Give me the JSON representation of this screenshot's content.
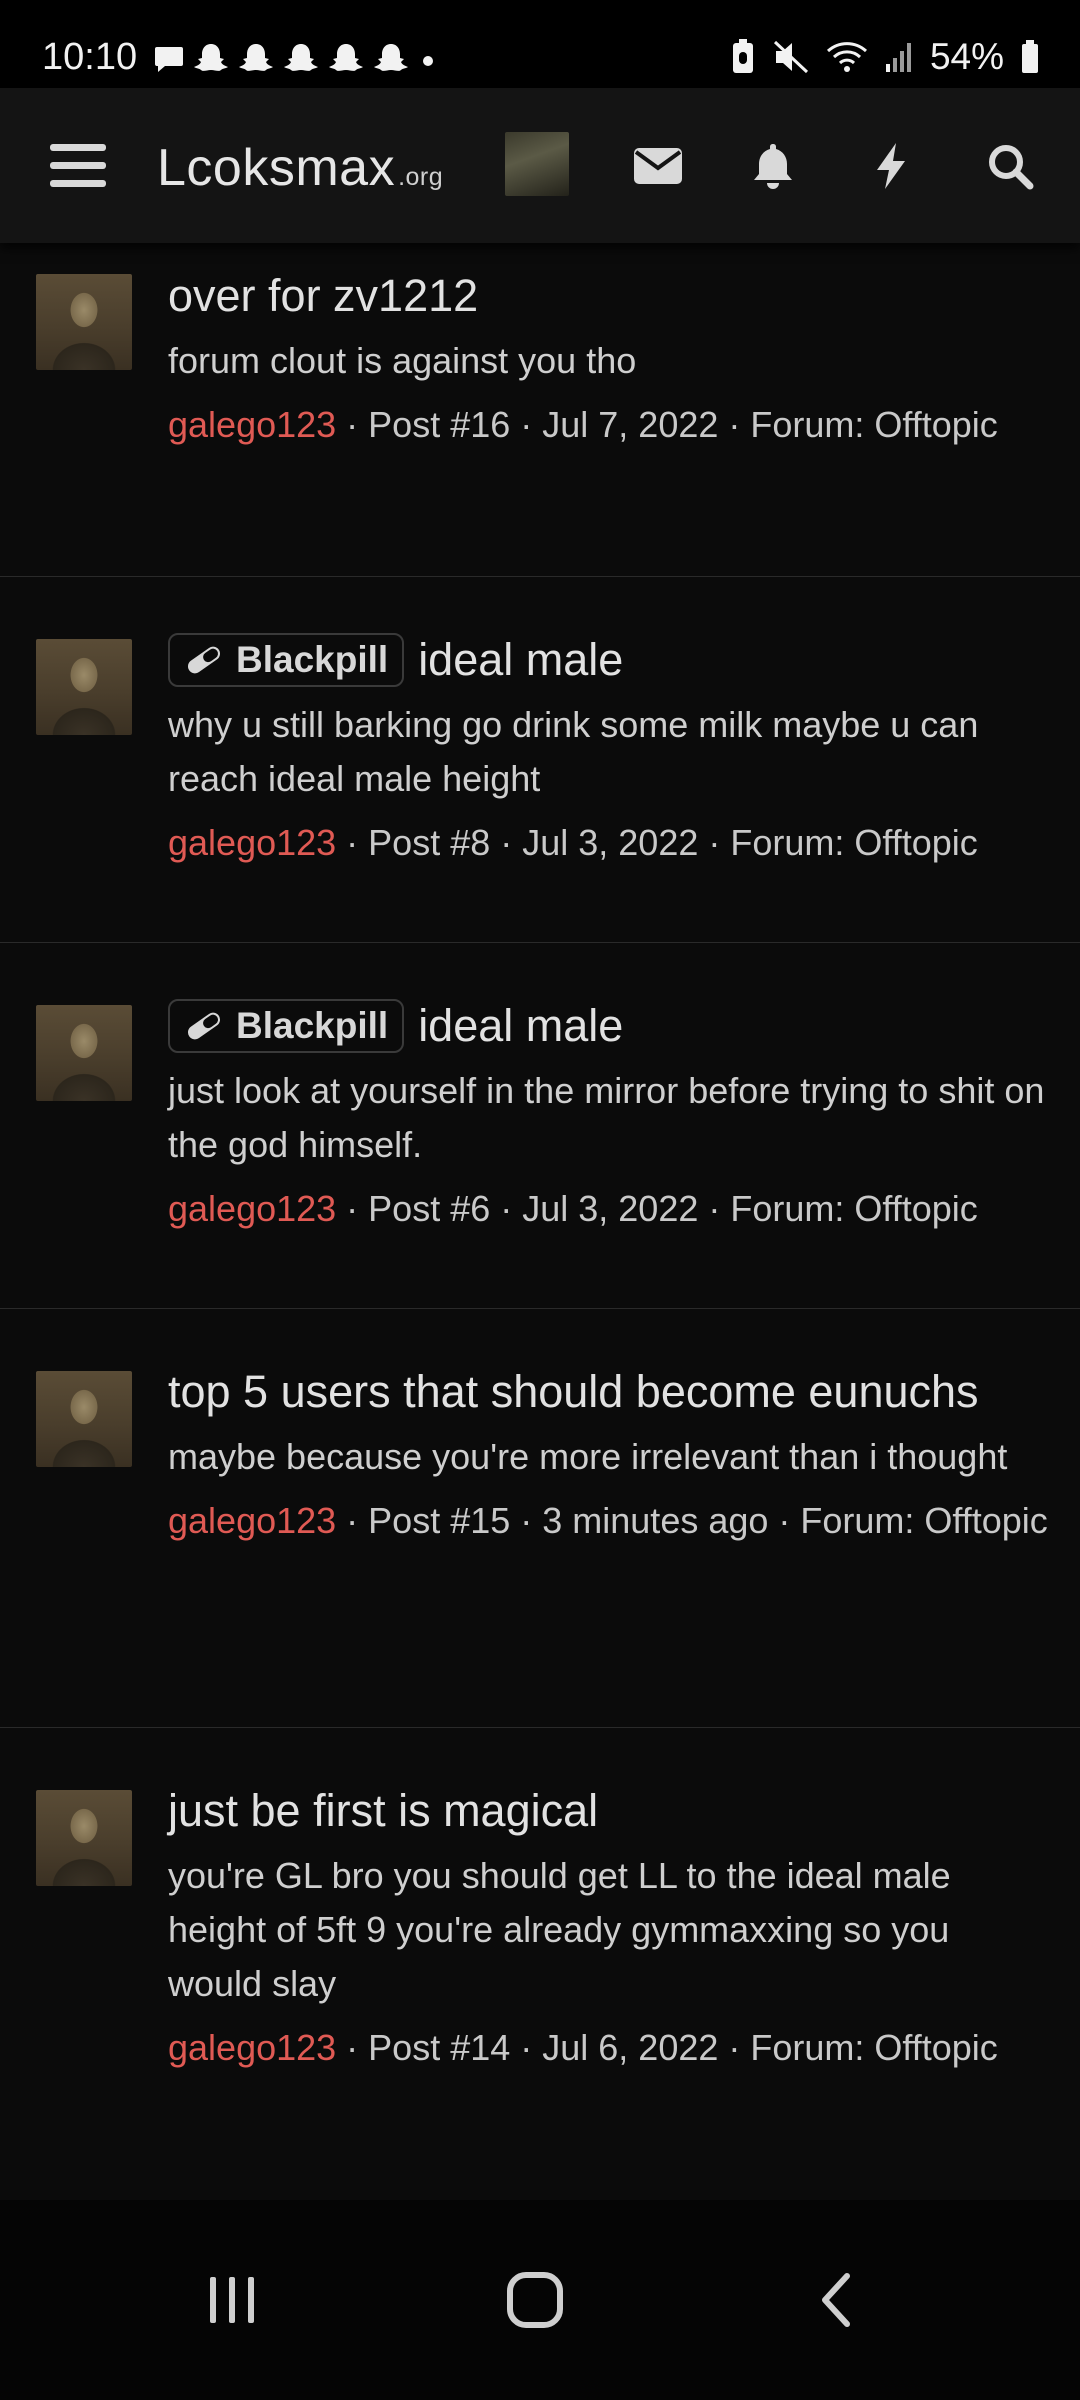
{
  "status_bar": {
    "time": "10:10",
    "battery": "54%",
    "notification_icons": [
      "message-icon",
      "snapchat-icon",
      "snapchat-icon",
      "snapchat-icon",
      "snapchat-icon",
      "snapchat-icon",
      "dot-icon"
    ]
  },
  "header": {
    "logo_main": "Lcoksmax",
    "logo_suffix": ".org",
    "icons": [
      "menu-icon",
      "avatar",
      "envelope-icon",
      "bell-icon",
      "bolt-icon",
      "search-icon"
    ]
  },
  "results": [
    {
      "prefix": "",
      "title": "over for zv1212",
      "snippet": "forum clout is against you tho",
      "author": "galego123",
      "meta": " · Post #16 · Jul 7, 2022 · Forum: Offtopic"
    },
    {
      "prefix": "Blackpill",
      "title": "ideal male",
      "snippet": "why u still barking go drink some milk maybe u can reach ideal male height",
      "author": "galego123",
      "meta": " · Post #8 · Jul 3, 2022 · Forum: Offtopic"
    },
    {
      "prefix": "Blackpill",
      "title": "ideal male",
      "snippet": "just look at yourself in the mirror before trying to shit on the god himself.",
      "author": "galego123",
      "meta": " · Post #6 · Jul 3, 2022 · Forum: Offtopic"
    },
    {
      "prefix": "",
      "title": "top 5 users that should become eunuchs",
      "snippet": "maybe because you're more irrelevant than i thought",
      "author": "galego123",
      "meta": " · Post #15 · 3 minutes ago · Forum: Offtopic"
    },
    {
      "prefix": "",
      "title": "just be first is magical",
      "snippet": "you're GL bro you should get LL to the ideal male height of 5ft 9 you're already gymmaxxing so you would slay",
      "author": "galego123",
      "meta": " · Post #14 · Jul 6, 2022 · Forum: Offtopic"
    }
  ],
  "nav_bar": {
    "icons": [
      "recents-icon",
      "home-icon",
      "back-icon"
    ]
  },
  "colors": {
    "background": "#0b0b0b",
    "header": "#141414",
    "author": "#e05a54",
    "divider": "#2a2a2a"
  }
}
